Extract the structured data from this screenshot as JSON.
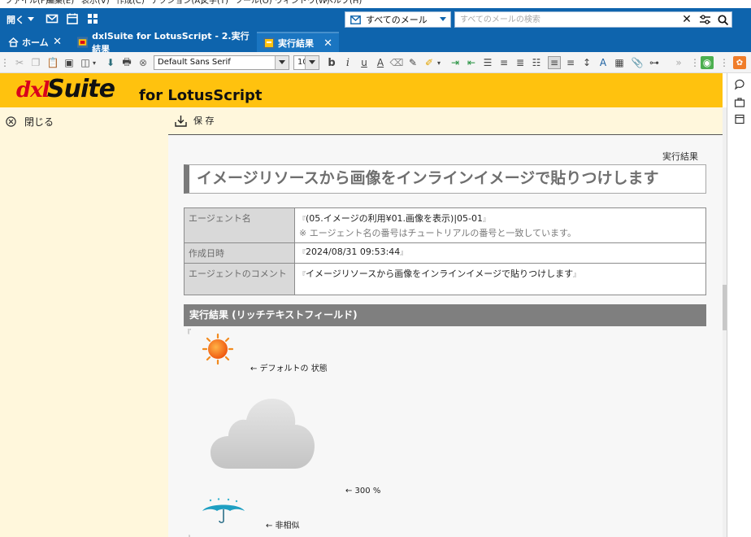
{
  "menu": [
    "ファイル(F)",
    "編集(E)",
    "表示(V)",
    "作成(C)",
    "アクション(A)",
    "文字(T)",
    "ツール(O)",
    "ウィンドウ(W)",
    "ヘルプ(H)"
  ],
  "toolbar": {
    "open_label": "開く",
    "mail_select": "すべてのメール",
    "search_placeholder": "すべてのメールの検索"
  },
  "tabs": [
    {
      "label": "ホーム"
    },
    {
      "label": "dxlSuite for LotusScript - 2.実行結果"
    },
    {
      "label": "実行結果"
    }
  ],
  "editor": {
    "font_name": "Default Sans Serif",
    "font_size": "10"
  },
  "banner": {
    "logo_dxl": "dxl",
    "logo_suite": "Suite",
    "logo_for": "for LotusScript"
  },
  "leftpane": {
    "close_label": "閉じる"
  },
  "actionbar": {
    "save_label": "保 存"
  },
  "document": {
    "label": "実行結果",
    "title": "イメージリソースから画像をインラインイメージで貼りつけします",
    "rows": [
      {
        "label": "エージェント名",
        "value": "(05.イメージの利用¥01.画像を表示)|05-01",
        "note": "※ エージェント名の番号はチュートリアルの番号と一致しています。"
      },
      {
        "label": "作成日時",
        "value": "2024/08/31 09:53:44"
      },
      {
        "label": "エージェントのコメント",
        "value": "イメージリソースから画像をインラインイメージで貼りつけします"
      }
    ],
    "result_header": "実行結果 (リッチテキストフィールド)",
    "captions": [
      "← デフォルトの 状態",
      "← 300 %",
      "← 非相似"
    ]
  },
  "colors": {
    "blue": "#0e64ad",
    "banner": "#ffc20e",
    "pane": "#fff7dc",
    "logo_red": "#d8001c"
  }
}
